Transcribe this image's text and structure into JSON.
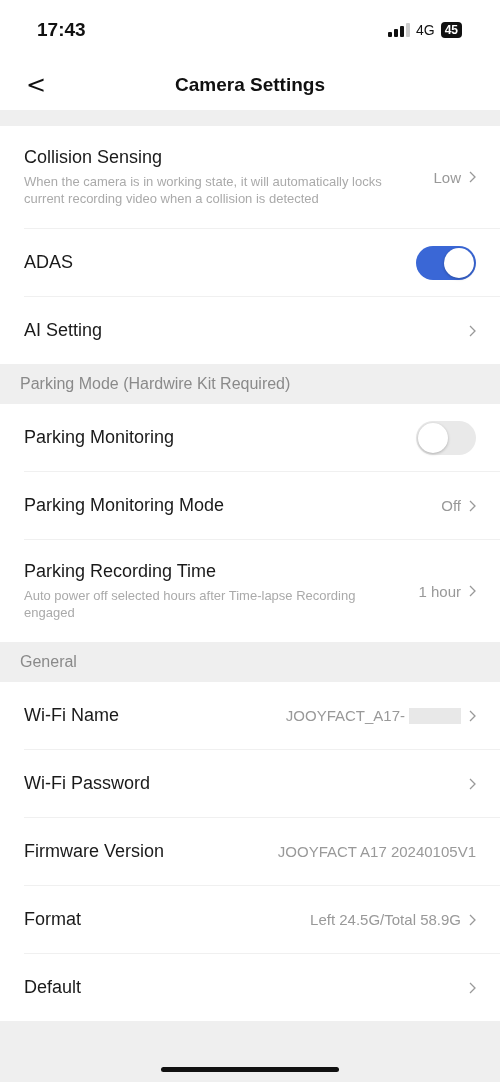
{
  "status_bar": {
    "time": "17:43",
    "network": "4G",
    "battery": "45"
  },
  "nav": {
    "back": "<",
    "title": "Camera Settings"
  },
  "sections": [
    {
      "items": [
        {
          "kind": "link",
          "label": "Collision Sensing",
          "description": "When the camera is in working state, it will automatically locks current recording video when a collision is detected",
          "value": "Low",
          "chevron": true
        },
        {
          "kind": "toggle",
          "label": "ADAS",
          "on": true
        },
        {
          "kind": "link",
          "label": "AI Setting",
          "chevron": true
        }
      ]
    },
    {
      "header": "Parking Mode (Hardwire Kit Required)",
      "items": [
        {
          "kind": "toggle",
          "label": "Parking Monitoring",
          "on": false
        },
        {
          "kind": "link",
          "label": "Parking Monitoring Mode",
          "value": "Off",
          "chevron": true
        },
        {
          "kind": "link",
          "label": "Parking Recording Time",
          "description": "Auto power off selected hours after Time-lapse Recording engaged",
          "value": "1 hour",
          "chevron": true
        }
      ]
    },
    {
      "header": "General",
      "items": [
        {
          "kind": "link",
          "label": "Wi-Fi Name",
          "value": "JOOYFACT_A17-",
          "redacted": true,
          "chevron": true
        },
        {
          "kind": "link",
          "label": "Wi-Fi Password",
          "chevron": true
        },
        {
          "kind": "link",
          "label": "Firmware Version",
          "value": "JOOYFACT A17 20240105V1",
          "chevron": false
        },
        {
          "kind": "link",
          "label": "Format",
          "value": "Left 24.5G/Total 58.9G",
          "chevron": true
        },
        {
          "kind": "link",
          "label": "Default",
          "chevron": true
        }
      ]
    }
  ]
}
